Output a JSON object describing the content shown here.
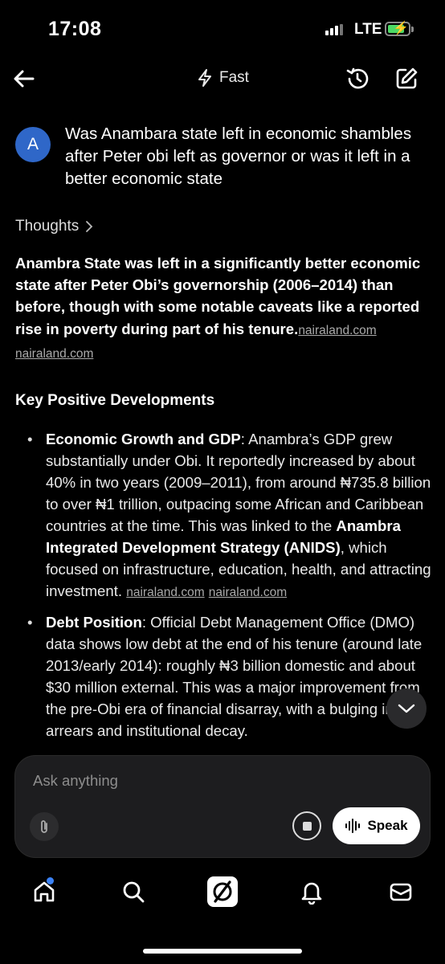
{
  "status_bar": {
    "time": "17:08",
    "network": "LTE"
  },
  "header": {
    "mode_label": "Fast"
  },
  "question": {
    "avatar_letter": "A",
    "text": "Was Anambara state left in economic shambles after Peter obi left as governor or was it left in a better economic state"
  },
  "thoughts_label": "Thoughts",
  "answer": {
    "text": "Anambra State was left in a significantly better economic state after Peter Obi’s governorship (2006–2014) than before, though with some notable caveats like a reported rise in poverty during part of his tenure.",
    "sources": [
      "nairaland.com",
      "nairaland.com"
    ]
  },
  "section_title": "Key Positive Developments",
  "bullets": [
    {
      "title": "Economic Growth and GDP",
      "text1": ": Anambra’s GDP grew substantially under Obi. It reportedly increased by about 40% in two years (2009–2011), from around ₦735.8 billion to over ₦1 trillion, outpacing some African and Caribbean countries at the time. This was linked to the ",
      "bold2": "Anambra Integrated Development Strategy (ANIDS)",
      "text2": ", which focused on infrastructure, education, health, and attracting investment. ",
      "sources": [
        "nairaland.com",
        "nairaland.com"
      ]
    },
    {
      "title": "Debt Position",
      "text1": ": Official Debt Management Office (DMO) data shows low debt at the end of his tenure (around late 2013/early 2014): roughly ₦3 billion domestic and about $30 million external. This was a major improvement from the pre-Obi era of financial disarray, with a bulging in arrears and institutional decay."
    }
  ],
  "composer": {
    "placeholder": "Ask anything",
    "speak_label": "Speak"
  },
  "colors": {
    "accent_blue": "#2f67c8",
    "battery_green": "#4cd964",
    "notification_dot": "#3b82f6"
  }
}
